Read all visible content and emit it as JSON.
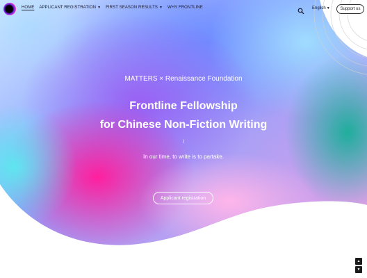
{
  "nav": {
    "items": [
      {
        "label": "HOME",
        "has_dropdown": false,
        "active": true
      },
      {
        "label": "APPLICANT REGISTRATION",
        "has_dropdown": true,
        "active": false
      },
      {
        "label": "FIRST SEASON RESULTS",
        "has_dropdown": true,
        "active": false
      },
      {
        "label": "WHY FRONTLINE",
        "has_dropdown": false,
        "active": false
      }
    ],
    "language": "English",
    "support_label": "Support us",
    "search_icon": "search-icon"
  },
  "hero": {
    "subtitle": "MATTERS × Renaissance Foundation",
    "title_line1": "Frontline Fellowship",
    "title_line2": "for Chinese Non-Fiction Writing",
    "divider": "/",
    "tagline": "In our time, to write is to partake.",
    "cta_label": "Applicant registration"
  },
  "colors": {
    "blue": "#6f8dff",
    "purple": "#8a5cf0",
    "magenta": "#ff2fa8",
    "cyan": "#5ee6f0",
    "teal": "#27b3a6",
    "pink": "#ffb3e6",
    "accent_dark": "#1b1b1b"
  }
}
